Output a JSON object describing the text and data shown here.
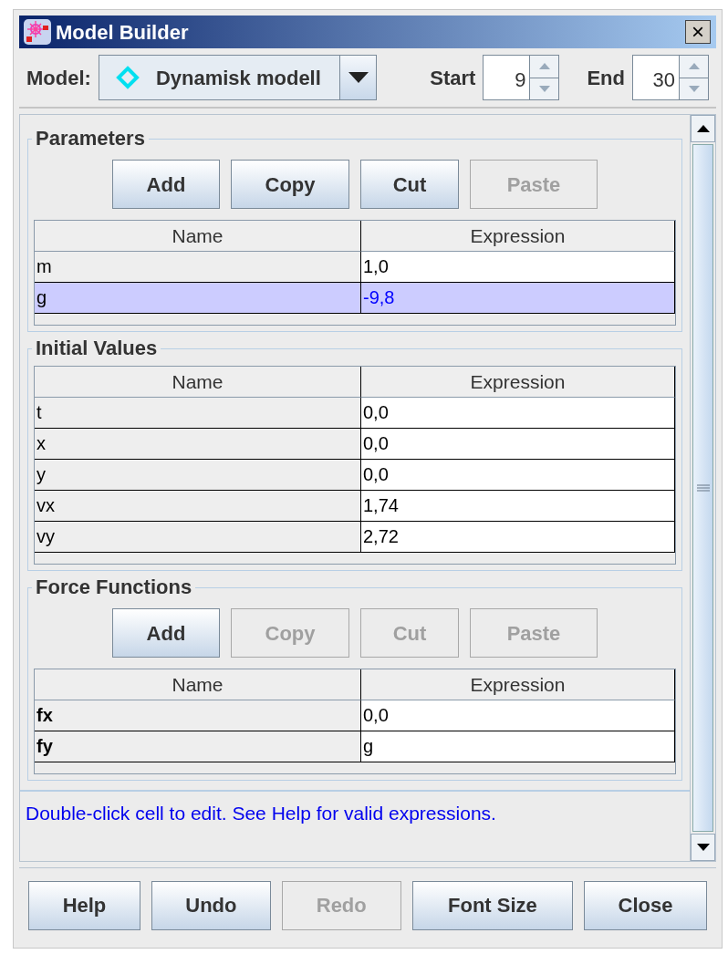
{
  "window": {
    "title": "Model Builder",
    "close": "×"
  },
  "toolbar": {
    "model_label": "Model:",
    "model": "Dynamisk modell",
    "start_label": "Start",
    "start": "9",
    "end_label": "End",
    "end": "30"
  },
  "sections": [
    {
      "title": "Parameters",
      "buttons": [
        {
          "label": "Add",
          "disabled": false
        },
        {
          "label": "Copy",
          "disabled": false
        },
        {
          "label": "Cut",
          "disabled": false
        },
        {
          "label": "Paste",
          "disabled": true
        }
      ],
      "columns": [
        "Name",
        "Expression"
      ],
      "rows": [
        {
          "name": "m",
          "expression": "1,0",
          "selected": false,
          "bold": false
        },
        {
          "name": "g",
          "expression": "-9,8",
          "selected": true,
          "bold": false
        }
      ]
    },
    {
      "title": "Initial Values",
      "columns": [
        "Name",
        "Expression"
      ],
      "rows": [
        {
          "name": "t",
          "expression": "0,0",
          "selected": false,
          "bold": false
        },
        {
          "name": "x",
          "expression": "0,0",
          "selected": false,
          "bold": false
        },
        {
          "name": "y",
          "expression": "0,0",
          "selected": false,
          "bold": false
        },
        {
          "name": "vx",
          "expression": "1,74",
          "selected": false,
          "bold": false
        },
        {
          "name": "vy",
          "expression": "2,72",
          "selected": false,
          "bold": false
        }
      ]
    },
    {
      "title": "Force Functions",
      "buttons": [
        {
          "label": "Add",
          "disabled": false
        },
        {
          "label": "Copy",
          "disabled": true
        },
        {
          "label": "Cut",
          "disabled": true
        },
        {
          "label": "Paste",
          "disabled": true
        }
      ],
      "columns": [
        "Name",
        "Expression"
      ],
      "rows": [
        {
          "name": "fx",
          "expression": "0,0",
          "selected": false,
          "bold": true
        },
        {
          "name": "fy",
          "expression": "g",
          "selected": false,
          "bold": true
        }
      ]
    }
  ],
  "hint": "Double-click cell to edit. See Help for valid expressions.",
  "footer_buttons": [
    {
      "label": "Help",
      "disabled": false
    },
    {
      "label": "Undo",
      "disabled": false
    },
    {
      "label": "Redo",
      "disabled": true
    },
    {
      "label": "Font Size",
      "disabled": false
    },
    {
      "label": "Close",
      "disabled": false
    }
  ]
}
